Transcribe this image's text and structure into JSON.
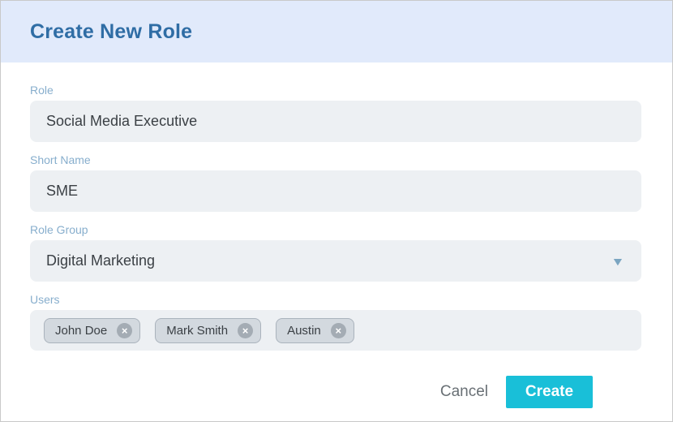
{
  "header": {
    "title": "Create New Role"
  },
  "form": {
    "role": {
      "label": "Role",
      "value": "Social Media Executive"
    },
    "short_name": {
      "label": "Short Name",
      "value": "SME"
    },
    "role_group": {
      "label": "Role Group",
      "value": "Digital Marketing"
    },
    "users": {
      "label": "Users",
      "tags": [
        {
          "name": "John Doe"
        },
        {
          "name": "Mark Smith"
        },
        {
          "name": "Austin"
        }
      ]
    }
  },
  "footer": {
    "cancel_label": "Cancel",
    "create_label": "Create"
  },
  "icons": {
    "dropdown_glyph": "▼",
    "remove_glyph": "×"
  },
  "colors": {
    "header_bg": "#e1eafb",
    "title_text": "#2f6da5",
    "label_text": "#87aecd",
    "field_bg": "#edf0f3",
    "field_text": "#3b4045",
    "chevron": "#7ba5c1",
    "tag_bg": "#d3d9df",
    "tag_border": "#aab3bc",
    "tag_remove_bg": "#a4acb4",
    "cancel_text": "#697075",
    "create_bg": "#19bfd8",
    "create_text": "#ffffff"
  }
}
